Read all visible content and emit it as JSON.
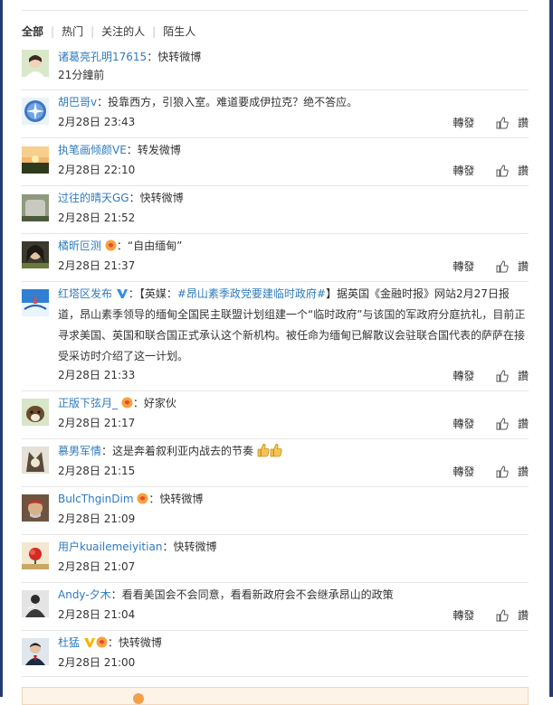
{
  "tabs": [
    "全部",
    "热门",
    "关注的人",
    "陌生人"
  ],
  "actions": {
    "forward": "轉發",
    "reply": "讚"
  },
  "colors": {
    "link": "#2f7bbd",
    "frame": "#243b73",
    "divider": "#e6e6e6"
  },
  "comments": [
    {
      "user": "诸葛亮孔明17615",
      "sep": "：",
      "text": "快转微博",
      "time": "21分鐘前",
      "show_actions": false,
      "badges": []
    },
    {
      "user": "胡巴哥v",
      "sep": "：",
      "text": "投靠西方，引狼入室。难道要成伊拉克？绝不答应。",
      "time": "2月28日 23:43",
      "show_actions": true,
      "badges": []
    },
    {
      "user": "执笔画倾颜VE",
      "sep": "：",
      "text": "转发微博",
      "time": "2月28日 22:10",
      "show_actions": true,
      "badges": []
    },
    {
      "user": "过往的晴天GG",
      "sep": "：",
      "text": "快转微博",
      "time": "2月28日 21:52",
      "show_actions": false,
      "badges": []
    },
    {
      "user": "橘昕叵测",
      "sep": "：",
      "text": "“自由缅甸”",
      "time": "2月28日 21:37",
      "show_actions": true,
      "badges": [
        "fan-badge"
      ]
    },
    {
      "user": "红塔区发布",
      "sep": "：",
      "text_prefix": "【英媒：",
      "text_topic": "#昂山素季政党要建临时政府#",
      "text_rest": "】据英国《金融时报》网站2月27日报道，昂山素季领导的缅甸全国民主联盟计划组建一个“临时政府”与该国的军政府分庭抗礼，目前正寻求美国、英国和联合国正式承认这个新机构。被任命为缅甸已解散议会驻联合国代表的萨萨在接受采访时介绍了这一计划。",
      "time": "2月28日 21:33",
      "show_actions": true,
      "badges": [
        "verified-badge"
      ]
    },
    {
      "user": "正版下弦月_",
      "sep": "：",
      "text": "好家伙",
      "time": "2月28日 21:17",
      "show_actions": true,
      "badges": [
        "fan-badge"
      ]
    },
    {
      "user": "慕男军情",
      "sep": "：",
      "text": "这是奔着叙利亚内战去的节奏",
      "time": "2月28日 21:15",
      "show_actions": true,
      "badges": []
    },
    {
      "user": "BulcThginDim",
      "sep": "：",
      "text": "快转微博",
      "time": "2月28日 21:09",
      "show_actions": false,
      "badges": [
        "fan-badge"
      ]
    },
    {
      "user": "用户kuailemeiyitian",
      "sep": "：",
      "text": "快转微博",
      "time": "2月28日 21:07",
      "show_actions": false,
      "badges": []
    },
    {
      "user": "Andy-夕木",
      "sep": "：",
      "text": "看看美国会不会同意，看看新政府会不会继承昂山的政策",
      "time": "2月28日 21:04",
      "show_actions": true,
      "badges": []
    },
    {
      "user": "杜猛",
      "sep": "：",
      "text": "快转微博",
      "time": "2月28日 21:00",
      "show_actions": false,
      "badges": [
        "yellow-v-badge",
        "fan-badge"
      ]
    }
  ]
}
